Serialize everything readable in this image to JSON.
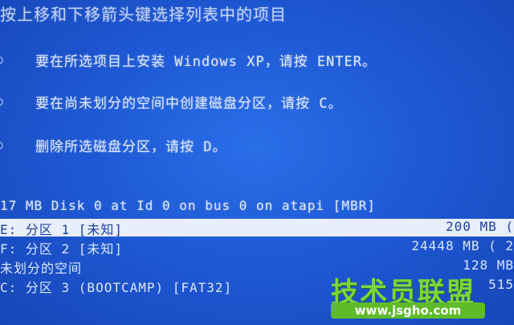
{
  "top_partial_text": "按上移和下移箭头键选择列表中的项目",
  "options": [
    {
      "bullet": "○",
      "text": "要在所选项目上安装 Windows XP，请按 ENTER。"
    },
    {
      "bullet": "○",
      "text": "要在尚未划分的空间中创建磁盘分区，请按 C。"
    },
    {
      "bullet": "○",
      "text": "删除所选磁盘分区，请按 D。"
    }
  ],
  "disk_header": "17 MB Disk 0 at Id 0 on bus 0 on atapi [MBR]",
  "partitions": [
    {
      "name": "E:  分区 1 [未知]",
      "size": "200 MB (",
      "selected": true
    },
    {
      "name": " F:  分区 2 [未知]",
      "size": "24448 MB ( 2",
      "selected": false
    },
    {
      "name": "     未划分的空间",
      "size": "128 MB",
      "selected": false
    },
    {
      "name": " C:  分区 3 (BOOTCAMP) [FAT32]",
      "size": "515",
      "selected": false
    }
  ],
  "watermark": {
    "title": "技术员联盟",
    "url": "www.jsgho.com"
  },
  "colors": {
    "background": "#1f5ad6",
    "highlight": "#e8eefc",
    "highlight_text": "#1b3fa0",
    "watermark": "#7dd63a"
  }
}
